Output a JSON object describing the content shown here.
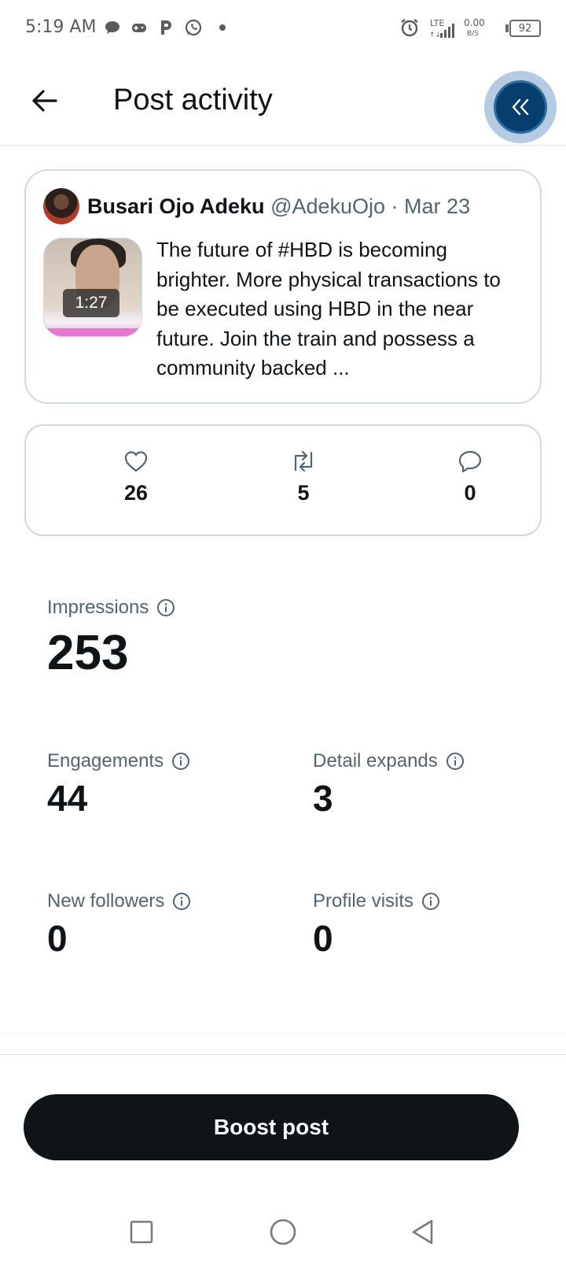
{
  "status_bar": {
    "time": "5:19 AM",
    "network": "LTE",
    "net_speed": "0.00",
    "net_unit": "B/S",
    "battery": "92",
    "icons": [
      "chat-bubble-icon",
      "gamepad-icon",
      "p-app-icon",
      "whatsapp-icon",
      "dot-icon",
      "alarm-icon",
      "signal-icon",
      "battery-icon"
    ]
  },
  "header": {
    "title": "Post activity",
    "back_icon": "arrow-left-icon",
    "floating_icon": "double-chevron-left-icon"
  },
  "post": {
    "author_name": "Busari Ojo Adeku",
    "handle": "@AdekuOjo",
    "separator": " · ",
    "date": "Mar 23",
    "video_duration": "1:27",
    "text": "The future of #HBD is becoming brighter. More physical transactions to be executed using HBD in the near future. Join the train and possess a community backed ..."
  },
  "engagement": {
    "likes": "26",
    "reposts": "5",
    "replies": "0"
  },
  "metrics": {
    "impressions_label": "Impressions",
    "impressions_value": "253",
    "engagements_label": "Engagements",
    "engagements_value": "44",
    "detail_expands_label": "Detail expands",
    "detail_expands_value": "3",
    "new_followers_label": "New followers",
    "new_followers_value": "0",
    "profile_visits_label": "Profile visits",
    "profile_visits_value": "0"
  },
  "actions": {
    "boost_label": "Boost post"
  },
  "colors": {
    "text_primary": "#0f1419",
    "text_secondary": "#536471",
    "border": "#cfd9de",
    "fab": "#063e6d",
    "button_dark": "#0f1419"
  }
}
